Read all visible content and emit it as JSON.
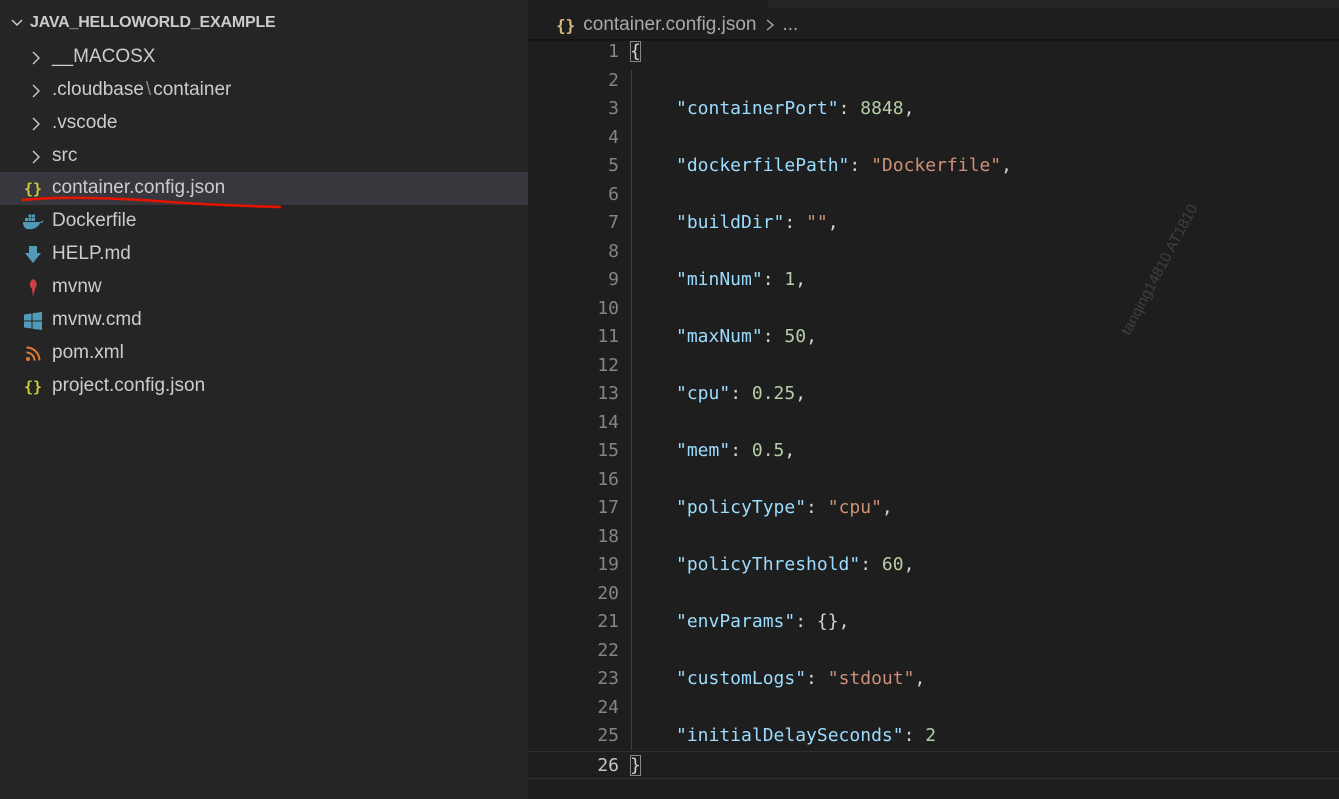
{
  "explorer": {
    "root_label": "JAVA_HELLOWORLD_EXAMPLE",
    "items": [
      {
        "label": "__MACOSX",
        "type": "folder"
      },
      {
        "label": ".cloudbase",
        "label2": "container",
        "separator": "\\",
        "type": "folder"
      },
      {
        "label": ".vscode",
        "type": "folder"
      },
      {
        "label": "src",
        "type": "folder"
      },
      {
        "label": "container.config.json",
        "type": "file",
        "icon": "json-braces-icon",
        "selected": true
      },
      {
        "label": "Dockerfile",
        "type": "file",
        "icon": "docker-whale-icon"
      },
      {
        "label": "HELP.md",
        "type": "file",
        "icon": "markdown-download-icon"
      },
      {
        "label": "mvnw",
        "type": "file",
        "icon": "maven-feather-icon"
      },
      {
        "label": "mvnw.cmd",
        "type": "file",
        "icon": "windows-icon"
      },
      {
        "label": "pom.xml",
        "type": "file",
        "icon": "rss-xml-icon"
      },
      {
        "label": "project.config.json",
        "type": "file",
        "icon": "json-braces-icon"
      }
    ]
  },
  "editor": {
    "breadcrumb": {
      "icon": "{}",
      "file": "container.config.json",
      "more": "..."
    },
    "current_line": "26",
    "lines": [
      {
        "n": "1",
        "text": "{"
      },
      {
        "n": "2",
        "text": ""
      },
      {
        "n": "3",
        "key": "\"containerPort\"",
        "value": "8848",
        "vtype": "num",
        "comma": ","
      },
      {
        "n": "4",
        "text": ""
      },
      {
        "n": "5",
        "key": "\"dockerfilePath\"",
        "value": "\"Dockerfile\"",
        "vtype": "str",
        "comma": ","
      },
      {
        "n": "6",
        "text": ""
      },
      {
        "n": "7",
        "key": "\"buildDir\"",
        "value": "\"\"",
        "vtype": "str",
        "comma": ","
      },
      {
        "n": "8",
        "text": ""
      },
      {
        "n": "9",
        "key": "\"minNum\"",
        "value": "1",
        "vtype": "num",
        "comma": ","
      },
      {
        "n": "10",
        "text": ""
      },
      {
        "n": "11",
        "key": "\"maxNum\"",
        "value": "50",
        "vtype": "num",
        "comma": ","
      },
      {
        "n": "12",
        "text": ""
      },
      {
        "n": "13",
        "key": "\"cpu\"",
        "value": "0.25",
        "vtype": "num",
        "comma": ","
      },
      {
        "n": "14",
        "text": ""
      },
      {
        "n": "15",
        "key": "\"mem\"",
        "value": "0.5",
        "vtype": "num",
        "comma": ","
      },
      {
        "n": "16",
        "text": ""
      },
      {
        "n": "17",
        "key": "\"policyType\"",
        "value": "\"cpu\"",
        "vtype": "str",
        "comma": ","
      },
      {
        "n": "18",
        "text": ""
      },
      {
        "n": "19",
        "key": "\"policyThreshold\"",
        "value": "60",
        "vtype": "num",
        "comma": ","
      },
      {
        "n": "20",
        "text": ""
      },
      {
        "n": "21",
        "key": "\"envParams\"",
        "value": "{}",
        "vtype": "punct",
        "comma": ","
      },
      {
        "n": "22",
        "text": ""
      },
      {
        "n": "23",
        "key": "\"customLogs\"",
        "value": "\"stdout\"",
        "vtype": "str",
        "comma": ","
      },
      {
        "n": "24",
        "text": ""
      },
      {
        "n": "25",
        "key": "\"initialDelaySeconds\"",
        "value": "2",
        "vtype": "num",
        "comma": ""
      },
      {
        "n": "26",
        "text": "}"
      }
    ],
    "watermark": "tanqing14810  AT1810"
  },
  "colors": {
    "sidebar_bg": "#252526",
    "editor_bg": "#1e1e1e",
    "selected_row": "#37373d",
    "json_key": "#9cdcfe",
    "json_number": "#b5cea8",
    "json_string": "#ce9178",
    "annotation_red": "#e51400"
  }
}
